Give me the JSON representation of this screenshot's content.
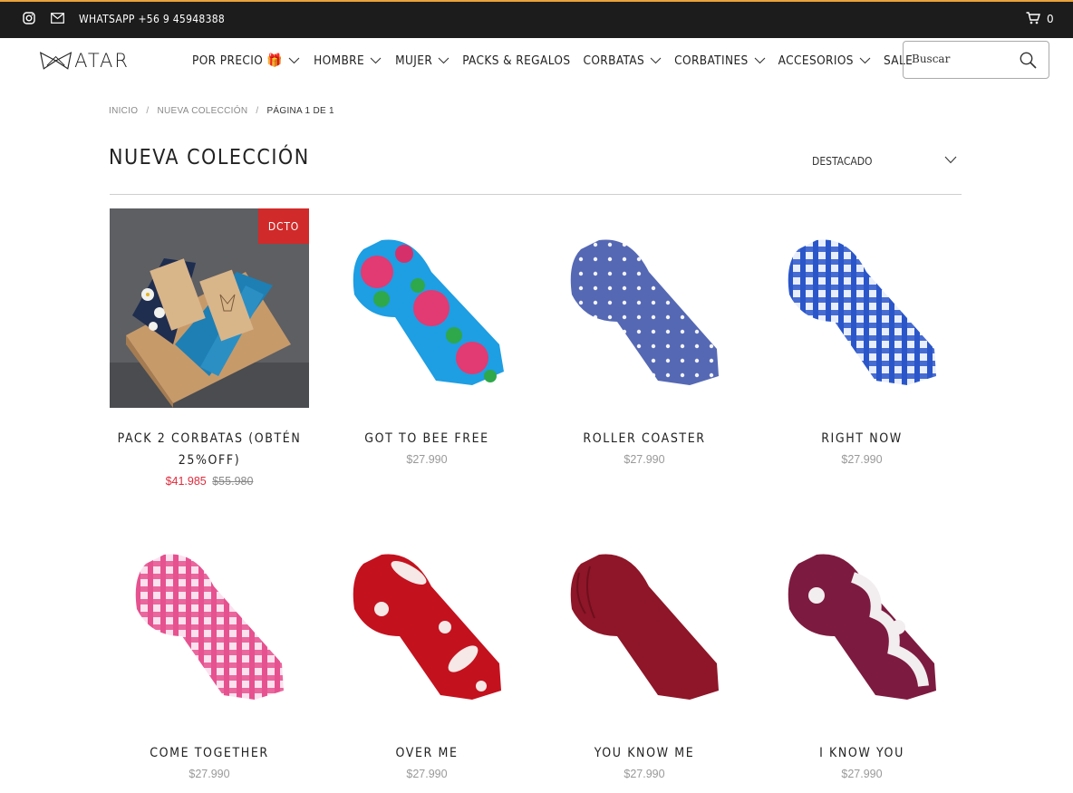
{
  "topbar": {
    "whatsapp": "WHATSAPP +56 9 45948388",
    "cart_count": "0"
  },
  "brand": {
    "logo_text": "ATAR"
  },
  "nav": {
    "items": [
      {
        "label": "POR PRECIO",
        "has_dropdown": true,
        "gift": "🎁"
      },
      {
        "label": "HOMBRE",
        "has_dropdown": true
      },
      {
        "label": "MUJER",
        "has_dropdown": true
      },
      {
        "label": "PACKS & REGALOS",
        "has_dropdown": false
      },
      {
        "label": "CORBATAS",
        "has_dropdown": true
      },
      {
        "label": "CORBATINES",
        "has_dropdown": true
      },
      {
        "label": "ACCESORIOS",
        "has_dropdown": true
      },
      {
        "label": "SALE",
        "has_dropdown": false
      }
    ]
  },
  "search": {
    "placeholder": "Buscar"
  },
  "breadcrumb": {
    "home": "INICIO",
    "collection": "NUEVA COLECCIÓN",
    "current": "PÁGINA 1 DE 1"
  },
  "page": {
    "title": "NUEVA COLECCIÓN",
    "sort_label": "DESTACADO"
  },
  "products": [
    {
      "name": "PACK 2 CORBATAS (OBTÉN 25%OFF)",
      "price": "$41.985",
      "old_price": "$55.980",
      "badge": "DCTO"
    },
    {
      "name": "GOT TO BEE FREE",
      "price": "$27.990"
    },
    {
      "name": "ROLLER COASTER",
      "price": "$27.990"
    },
    {
      "name": "RIGHT NOW",
      "price": "$27.990"
    },
    {
      "name": "COME TOGETHER",
      "price": "$27.990"
    },
    {
      "name": "OVER ME",
      "price": "$27.990"
    },
    {
      "name": "YOU KNOW ME",
      "price": "$27.990"
    },
    {
      "name": "I KNOW YOU",
      "price": "$27.990"
    }
  ],
  "colors": {
    "topbar_bg": "#1c1c1c",
    "topbar_accent": "#e9a23b",
    "sale_red": "#e02b3c",
    "badge_red": "#d12a2a"
  }
}
